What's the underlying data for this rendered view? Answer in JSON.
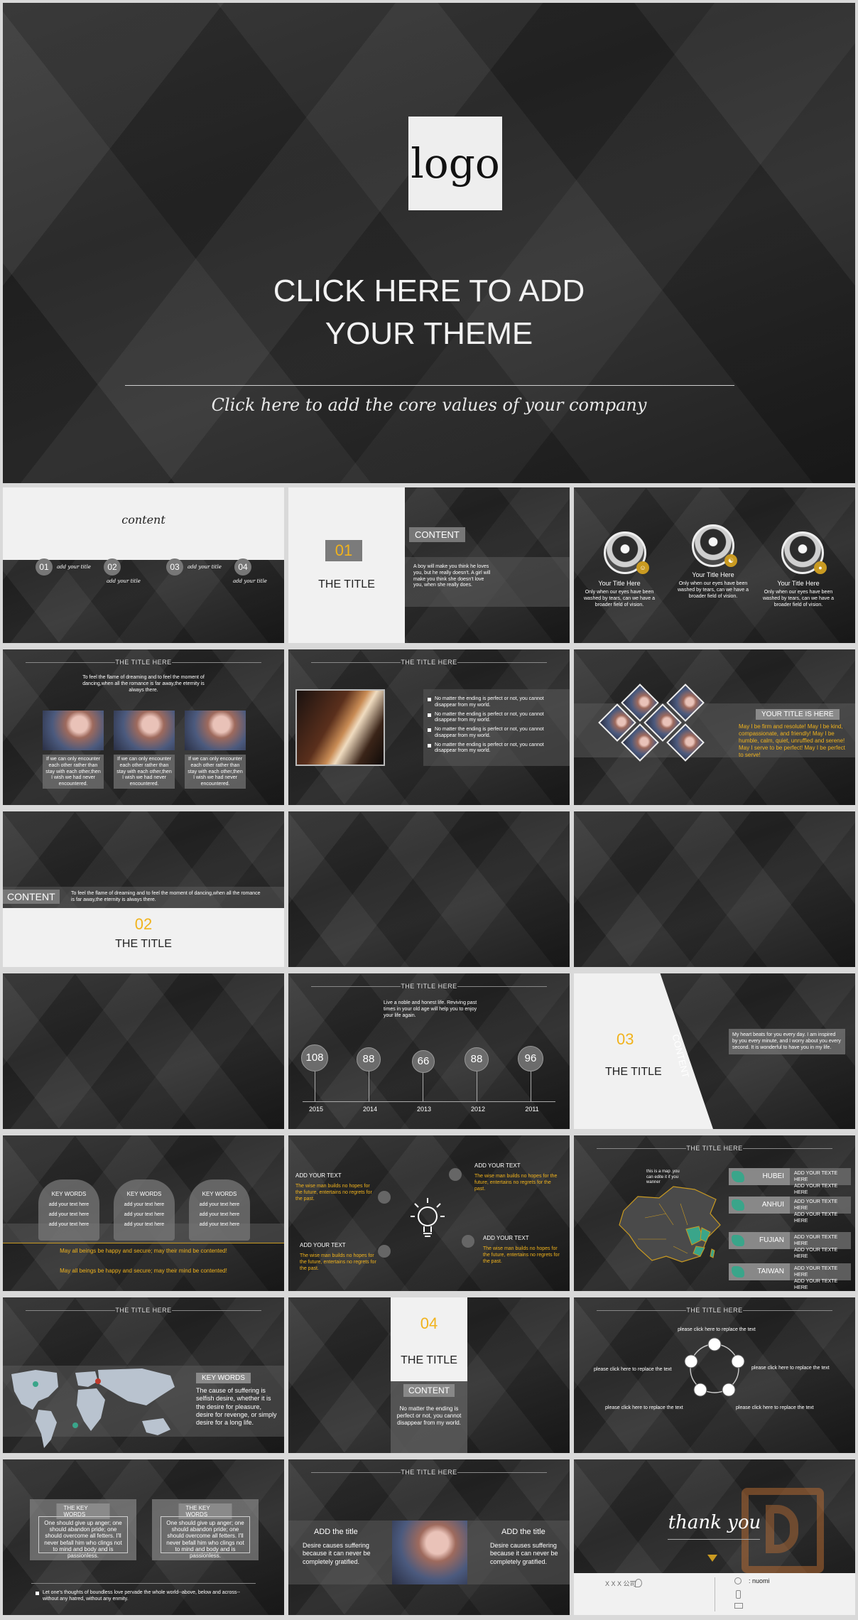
{
  "cover": {
    "logo": "logo",
    "title_line1": "CLICK HERE TO ADD",
    "title_line2": "YOUR THEME",
    "subtitle": "Click here to add the core values of your company"
  },
  "toc": {
    "title": "content",
    "items": [
      {
        "num": "01",
        "label": "add your title"
      },
      {
        "num": "02",
        "label": "add your title"
      },
      {
        "num": "03",
        "label": "add your title"
      },
      {
        "num": "04",
        "label": "add your title"
      }
    ]
  },
  "section01": {
    "num": "01",
    "title": "THE TITLE",
    "content_label": "CONTENT",
    "body": "A boy will make you think he loves you, but he really doesn't. A girl will make you think she doesn't love you, when she really does."
  },
  "team": {
    "members": [
      {
        "name": "Your Title Here",
        "text": "Only when our eyes have been washed by tears, can we have a broader field of vision."
      },
      {
        "name": "Your Title Here",
        "text": "Only when our eyes have been washed by tears, can we have a broader field of vision."
      },
      {
        "name": "Your Title Here",
        "text": "Only when our eyes have been washed by tears, can we have a broader field of vision."
      }
    ]
  },
  "photos3": {
    "heading": "THE TITLE HERE",
    "intro": "To feel the flame of dreaming and to feel the moment of dancing,when all the romance is far away,the eternity is always there.",
    "captions": [
      "If we can only encounter each other rather than stay with each other,then I wish we had never encountered.",
      "If we can only encounter each other rather than stay with each other,then I wish we had never encountered.",
      "If we can only encounter each other rather than stay with each other,then I wish we had never encountered."
    ]
  },
  "bullets": {
    "heading": "THE TITLE HERE",
    "items": [
      "No matter the ending is perfect or not, you cannot disappear from my world.",
      "No matter the ending is perfect or not, you cannot disappear from my world.",
      "No matter the ending is perfect or not, you cannot disappear from my world.",
      "No matter the ending is perfect or not, you cannot disappear from my world."
    ]
  },
  "diamonds": {
    "title": "YOUR TITLE IS HERE",
    "text": "May I be firm and resolute! May I be kind, compassionate, and friendly! May I be humble, calm, quiet, unruffled and serene! May I serve to be perfect! May I be perfect to serve!"
  },
  "section02": {
    "content_label": "CONTENT",
    "text": "To feel the flame of dreaming and to feel the moment of dancing,when all the romance is far away,the eternity is always there.",
    "num": "02",
    "title": "THE TITLE"
  },
  "timeline": {
    "heading": "THE TITLE HERE",
    "intro": "Live a noble and honest life. Reviving past times in your old age will help you to enjoy your life again.",
    "points": [
      {
        "value": "108",
        "year": "2015"
      },
      {
        "value": "88",
        "year": "2014"
      },
      {
        "value": "66",
        "year": "2013"
      },
      {
        "value": "88",
        "year": "2012"
      },
      {
        "value": "96",
        "year": "2011"
      }
    ]
  },
  "section03": {
    "num": "03",
    "title": "THE TITLE",
    "content_label": "CONTENT",
    "text": "My heart beats for you every day. I am inspired by you every minute, and I worry about you every second. It is wonderful to have you in my life."
  },
  "keywords": {
    "panels": [
      {
        "title": "KEY WORDS",
        "lines": [
          "add your text here",
          "add your text here",
          "add your text here"
        ]
      },
      {
        "title": "KEY WORDS",
        "lines": [
          "add your text here",
          "add your text here",
          "add your text here"
        ]
      },
      {
        "title": "KEY WORDS",
        "lines": [
          "add your text here",
          "add your text here",
          "add your text here"
        ]
      }
    ],
    "line1": "May all beings be happy and secure; may their mind be contented!",
    "line2": "May all beings be happy and secure; may their mind be contented!"
  },
  "bulb": {
    "blocks": [
      {
        "title": "ADD YOUR TEXT",
        "text": "The wise man builds no hopes for the future, entertains no regrets for the past."
      },
      {
        "title": "ADD YOUR TEXT",
        "text": "The wise man builds no hopes for the future, entertains no regrets for the past."
      },
      {
        "title": "ADD YOUR TEXT",
        "text": "The wise man builds no hopes for the future, entertains no regrets for the past."
      },
      {
        "title": "ADD YOUR TEXT",
        "text": "The wise man builds no hopes for the future, entertains no regrets for the past."
      }
    ]
  },
  "china": {
    "heading": "THE TITLE HERE",
    "note": "this is a map ,you can edite it if you wanner",
    "provinces": [
      {
        "name": "HUBEI",
        "desc1": "ADD YOUR TEXTE HERE",
        "desc2": "ADD YOUR TEXTE HERE"
      },
      {
        "name": "ANHUI",
        "desc1": "ADD YOUR TEXTE HERE",
        "desc2": "ADD YOUR TEXTE HERE"
      },
      {
        "name": "FUJIAN",
        "desc1": "ADD YOUR TEXTE HERE",
        "desc2": "ADD YOUR TEXTE HERE"
      },
      {
        "name": "TAIWAN",
        "desc1": "ADD YOUR TEXTE HERE",
        "desc2": "ADD YOUR TEXTE HERE"
      }
    ]
  },
  "world": {
    "heading": "THE TITLE HERE",
    "title": "KEY WORDS",
    "text": "The cause of suffering is selfish desire, whether it is the desire for pleasure, desire for revenge, or simply desire for a long life."
  },
  "section04": {
    "num": "04",
    "title": "THE TITLE",
    "content_label": "CONTENT",
    "text": "No matter the ending is perfect or not, you cannot disappear from my world."
  },
  "cycle": {
    "heading": "THE TITLE HERE",
    "labels": [
      "please click here to replace the text",
      "please click here to replace the text",
      "please click here to replace the text",
      "please click here to replace the text",
      "please click here to replace the text"
    ]
  },
  "keyframes": {
    "boxes": [
      {
        "title": "THE KEY WORDS",
        "text": "One should give up anger; one should abandon pride; one should overcome all fetters. I'll never befall him who clings not to mind and body and is passionless."
      },
      {
        "title": "THE KEY WORDS",
        "text": "One should give up anger; one should abandon pride; one should overcome all fetters. I'll never befall him who clings not to mind and body and is passionless."
      }
    ],
    "footer": "Let one's thoughts of boundless love pervade the whole world--above, below and across--without any hatred, without any enmity."
  },
  "split": {
    "heading": "THE TITLE HERE",
    "left_title": "ADD the title",
    "left_text": "Desire causes suffering because it can never be completely gratified.",
    "right_title": "ADD the title",
    "right_text": "Desire causes suffering because it can never be completely gratified."
  },
  "thanks": {
    "title": "thank you",
    "name": ": nuomi",
    "left_label": "X X X 公司"
  }
}
